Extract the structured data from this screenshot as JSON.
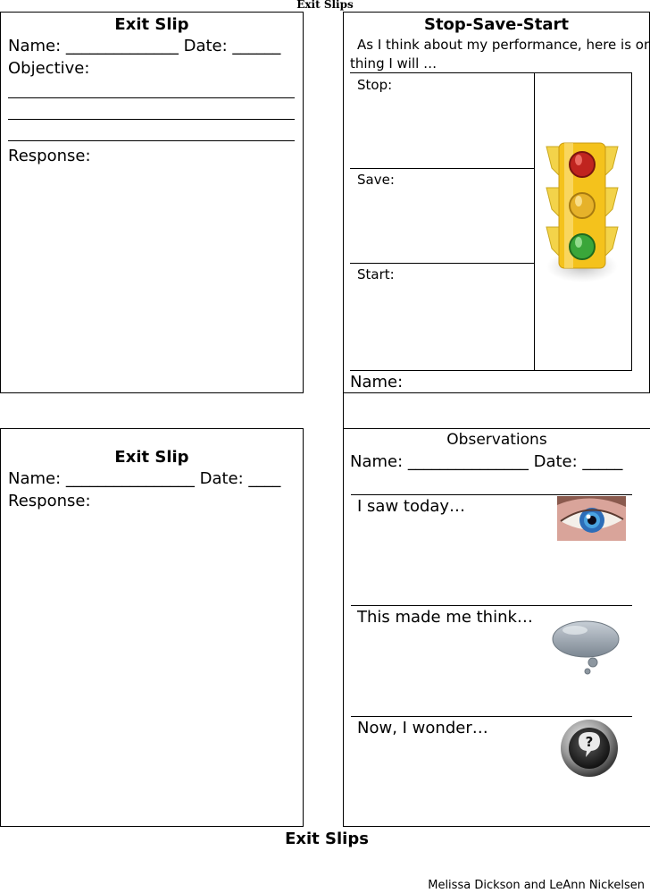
{
  "page_header": "Exit Slips",
  "slip1": {
    "title": "Exit Slip",
    "name_line": "Name: ______________ Date: ______",
    "objective_label": "Objective:",
    "response_label": "Response:"
  },
  "slip2": {
    "title": "Stop-Save-Start",
    "intro_line1": "As I think about my performance, here is one",
    "intro_line2": "thing I will …",
    "stop_label": "Stop:",
    "save_label": "Save:",
    "start_label": "Start:",
    "name_label": "Name:"
  },
  "slip3": {
    "title": "Exit Slip",
    "name_line": "Name: ________________ Date: ____",
    "response_label": "Response:"
  },
  "slip4": {
    "title": "Observations",
    "name_line": "Name: _______________ Date: _____",
    "prompt1": "I saw today…",
    "prompt2": "This made me think…",
    "prompt3": "Now, I wonder…"
  },
  "footer": {
    "title": "Exit Slips",
    "credit": "Melissa Dickson and LeAnn Nickelsen"
  }
}
